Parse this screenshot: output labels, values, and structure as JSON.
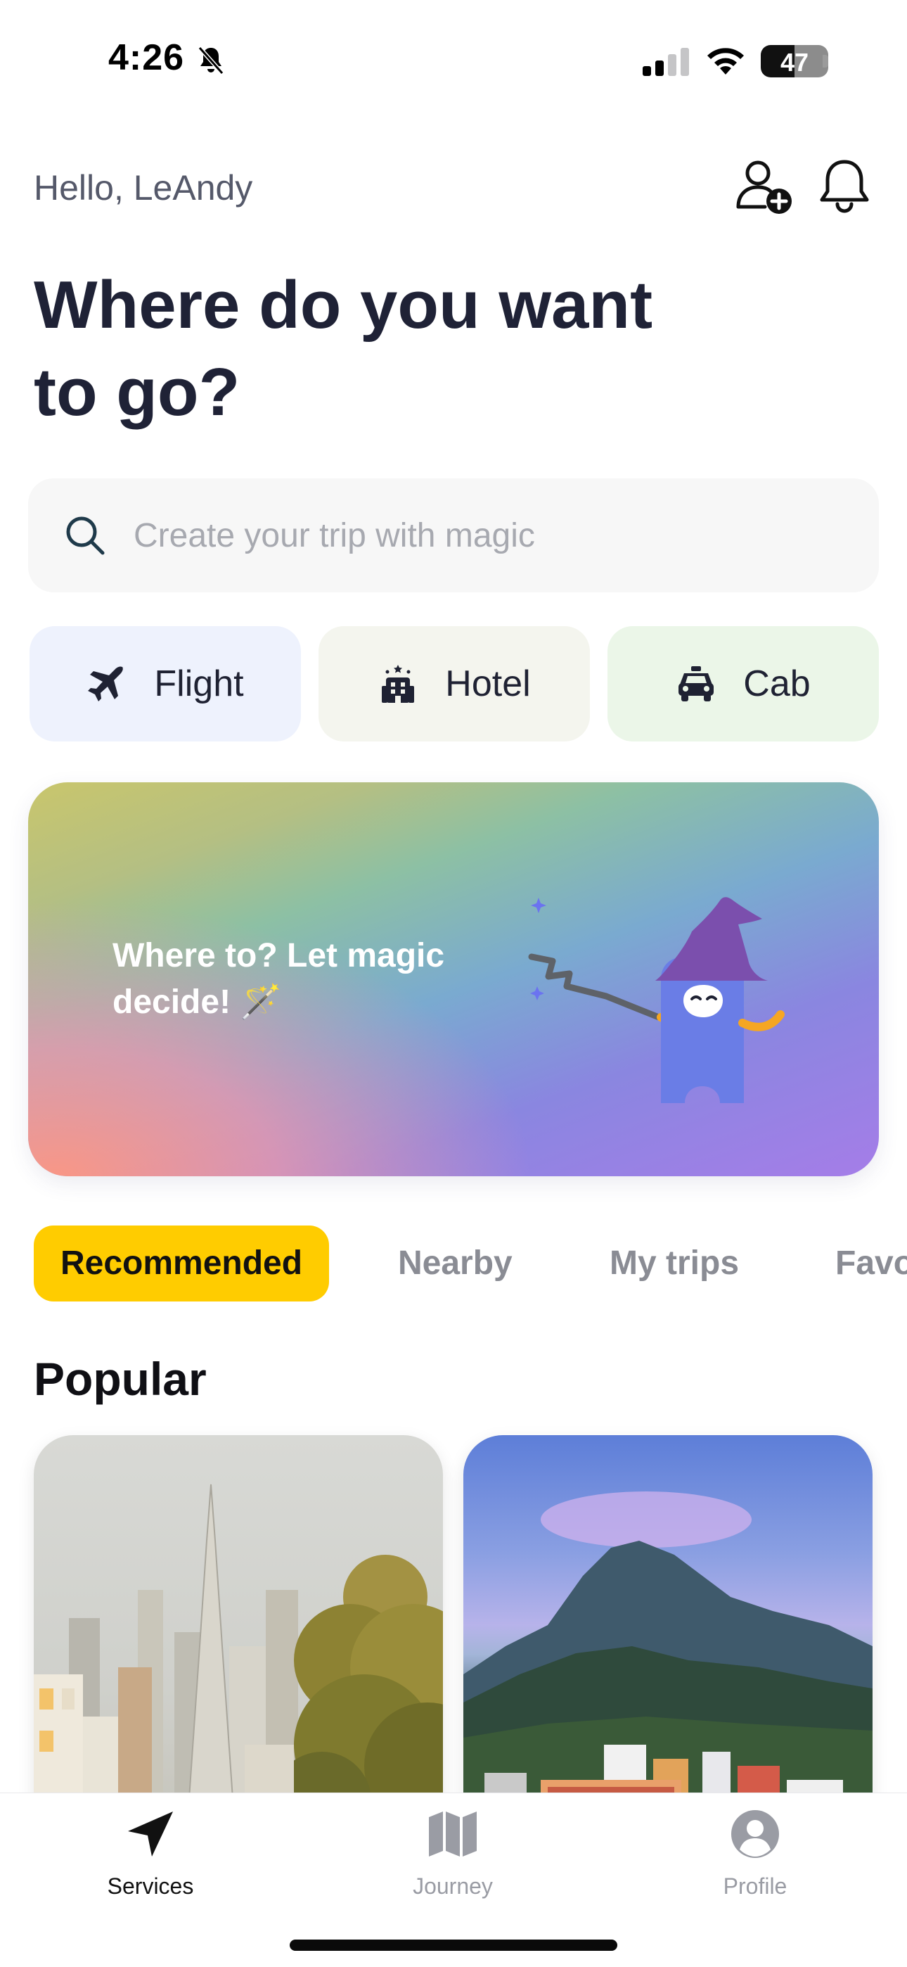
{
  "status": {
    "time": "4:26",
    "battery": "47"
  },
  "header": {
    "greeting": "Hello, LeAndy",
    "headline": "Where do you want to go?"
  },
  "search": {
    "placeholder": "Create your trip with magic",
    "value": ""
  },
  "categories": [
    {
      "label": "Flight",
      "icon": "airplane-icon",
      "color": "#eef2fd"
    },
    {
      "label": "Hotel",
      "icon": "hotel-icon",
      "color": "#f4f5ee"
    },
    {
      "label": "Cab",
      "icon": "taxi-icon",
      "color": "#ebf6e8"
    }
  ],
  "banner": {
    "text": "Where to? Let magic decide! 🪄",
    "mascot": "wizard-mascot"
  },
  "tabs": [
    {
      "label": "Recommended",
      "active": true
    },
    {
      "label": "Nearby",
      "active": false
    },
    {
      "label": "My trips",
      "active": false
    },
    {
      "label": "Favo",
      "active": false
    }
  ],
  "section": {
    "title": "Popular"
  },
  "cards": [
    {
      "image": "city-skyline-image"
    },
    {
      "image": "mountain-town-image"
    }
  ],
  "nav": [
    {
      "label": "Services",
      "icon": "navigation-arrow-icon",
      "active": true
    },
    {
      "label": "Journey",
      "icon": "map-icon",
      "active": false
    },
    {
      "label": "Profile",
      "icon": "profile-icon",
      "active": false
    }
  ],
  "colors": {
    "accent": "#ffcc00",
    "heading": "#1f2236",
    "muted": "#8a8c94"
  }
}
